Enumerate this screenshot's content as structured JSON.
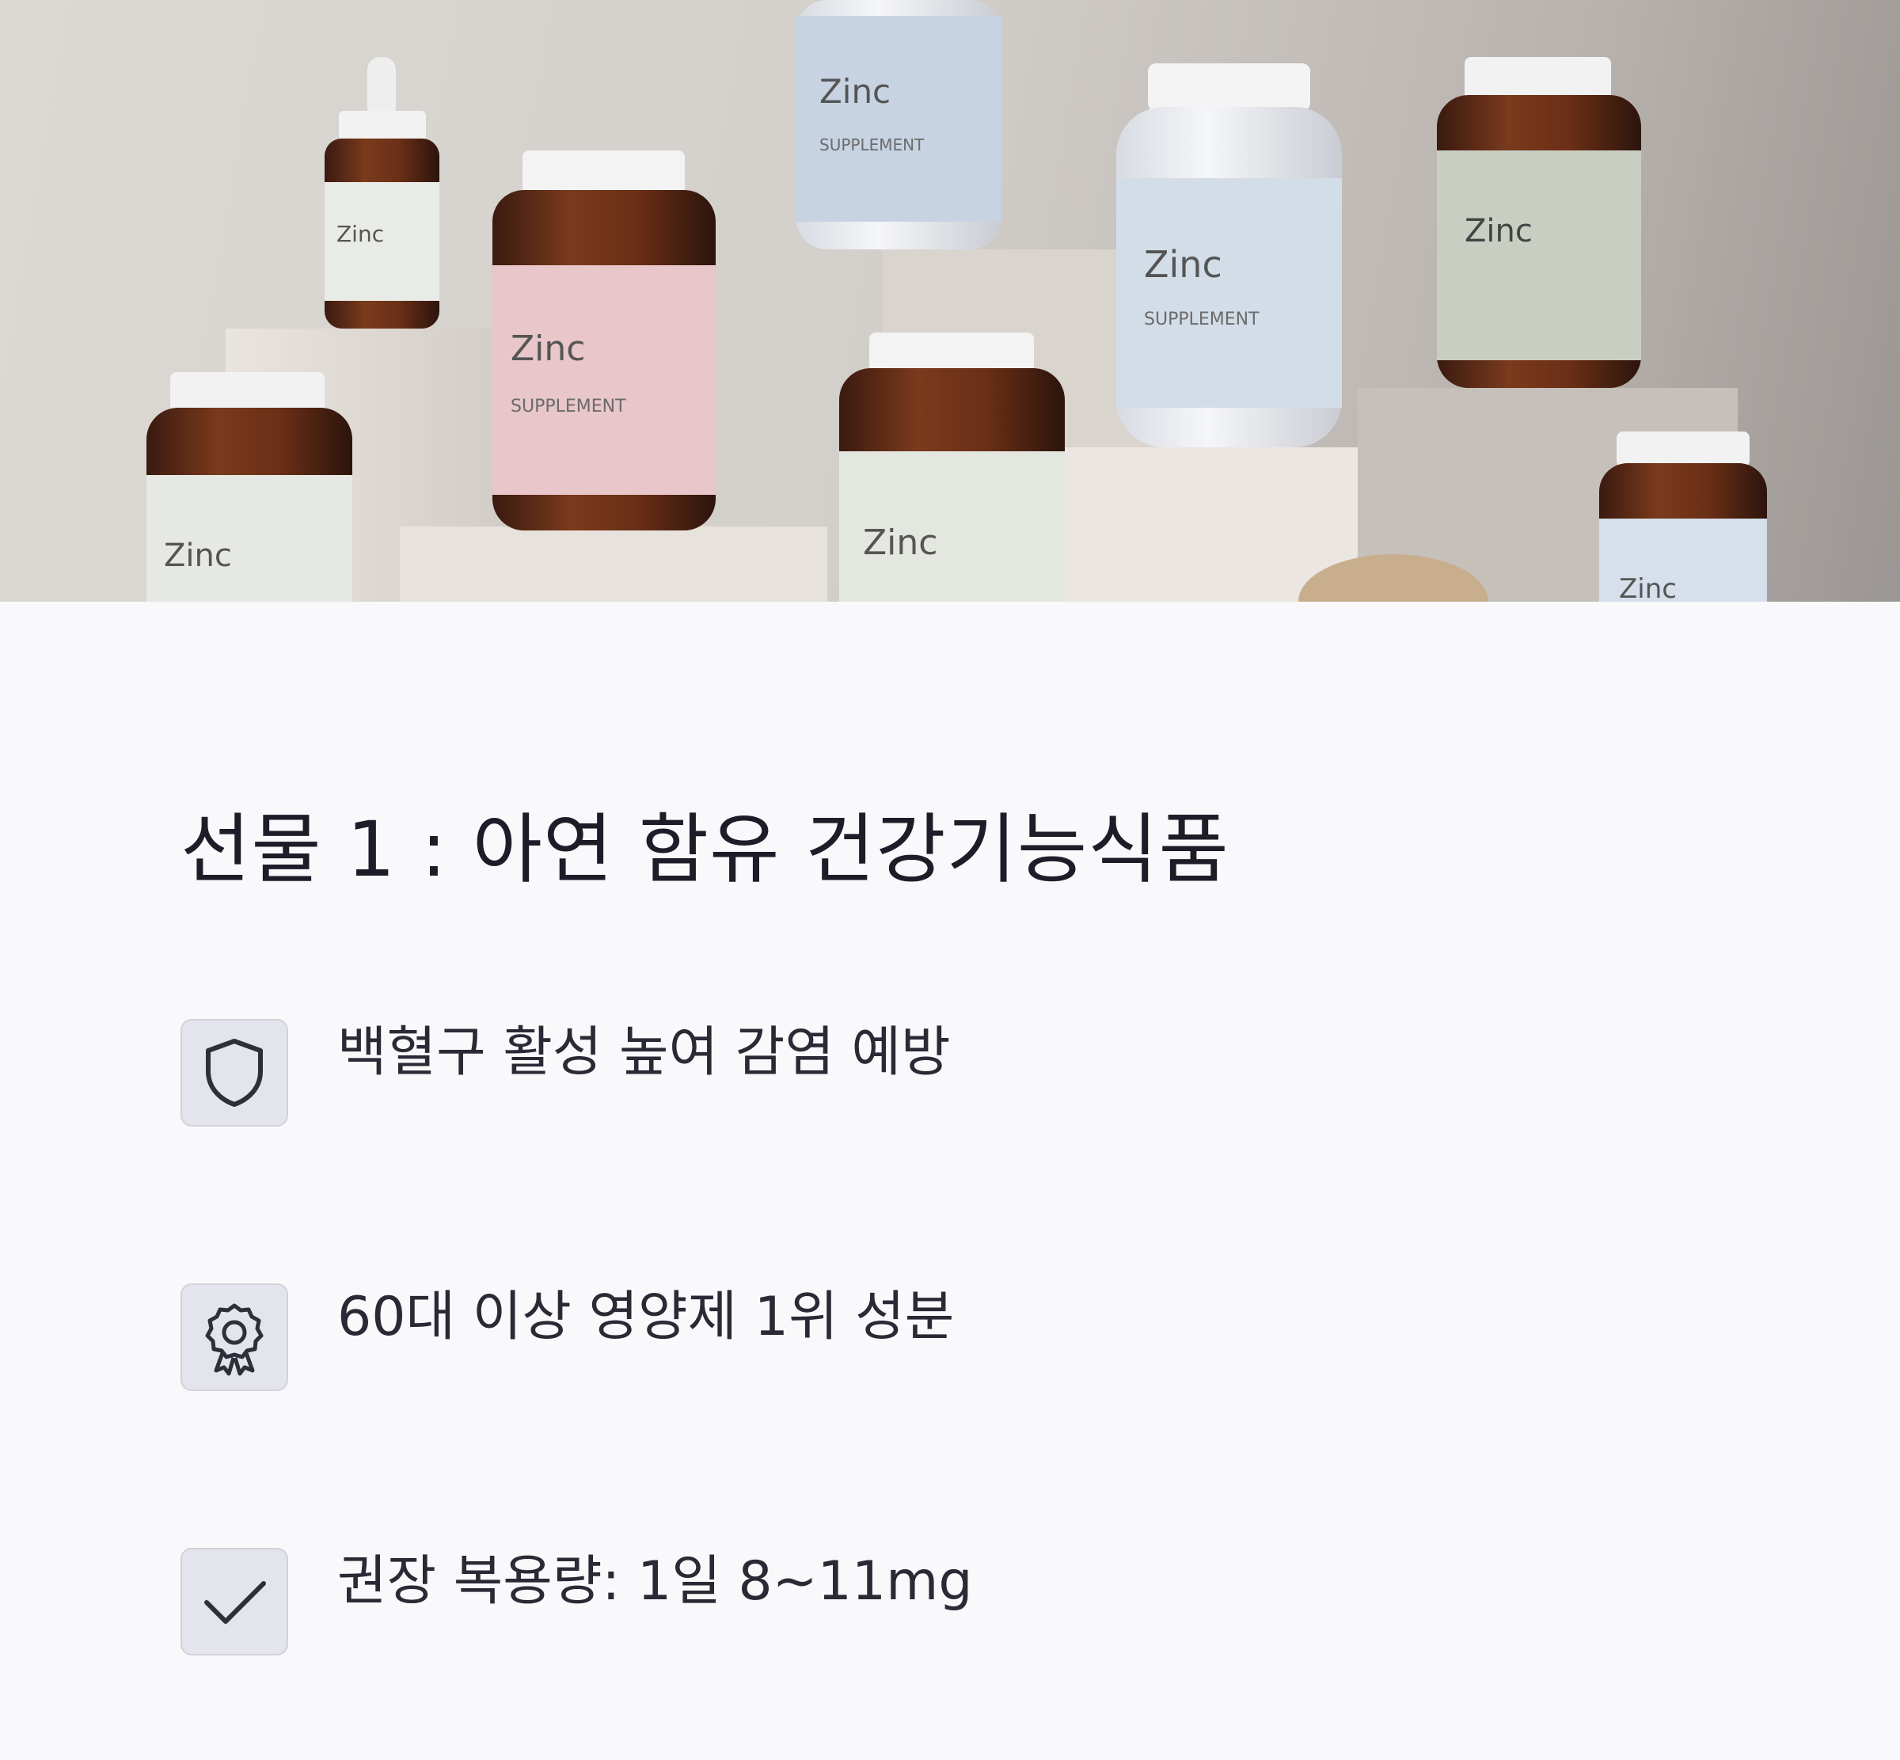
{
  "hero": {
    "image_description_icon": "supplement-bottles-photo",
    "bottle_label_text": "Zinc"
  },
  "title": "선물 1 : 아연 함유 건강기능식품",
  "features": [
    {
      "icon": "shield-icon",
      "text": "백혈구 활성 높여 감염 예방"
    },
    {
      "icon": "badge-icon",
      "text": "60대 이상 영양제 1위 성분"
    },
    {
      "icon": "check-icon",
      "text": "권장 복용량: 1일 8~11mg"
    }
  ],
  "colors": {
    "background": "#f9f9fb",
    "text": "#1d1d29",
    "icon_box": "#e4e4ec",
    "icon_stroke": "#2f2f3a"
  }
}
